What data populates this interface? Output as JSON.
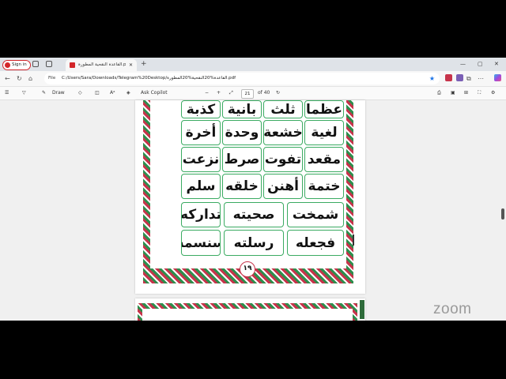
{
  "browser": {
    "sign_in": "Sign in",
    "tab_title": "القاعدة النقحية المطورة.pdf",
    "address_label": "File",
    "url": "C:/Users/Sara/Downloads/Telegram%20Desktop/القاعدة%20النقحية%20المطورة.pdf"
  },
  "pdf_toolbar": {
    "draw_label": "Draw",
    "copilot_label": "Ask Copilot",
    "zoom_out": "−",
    "zoom_in": "+",
    "page_current": "21",
    "page_total": "of 40"
  },
  "page": {
    "words": [
      [
        "عظما",
        "ثلث",
        "بانية",
        "كذبة"
      ],
      [
        "لغية",
        "خشعة",
        "وحدة",
        "أخرة"
      ],
      [
        "مقعد",
        "تفوت",
        "صرط",
        "نزعت"
      ],
      [
        "ختمة",
        "أهنن",
        "خلقه",
        "سلم"
      ],
      [
        "شمخت",
        "صحيته",
        "تداركه"
      ],
      [
        "فجعله",
        "رسلته",
        "سنسمه"
      ]
    ],
    "page_number": "١٩"
  },
  "overlay": {
    "zoom_watermark": "zoom"
  },
  "colors": {
    "border_red": "#c7344b",
    "border_green": "#2e8e4d",
    "cell_border": "#3bab62",
    "signin_accent": "#d3262a"
  }
}
